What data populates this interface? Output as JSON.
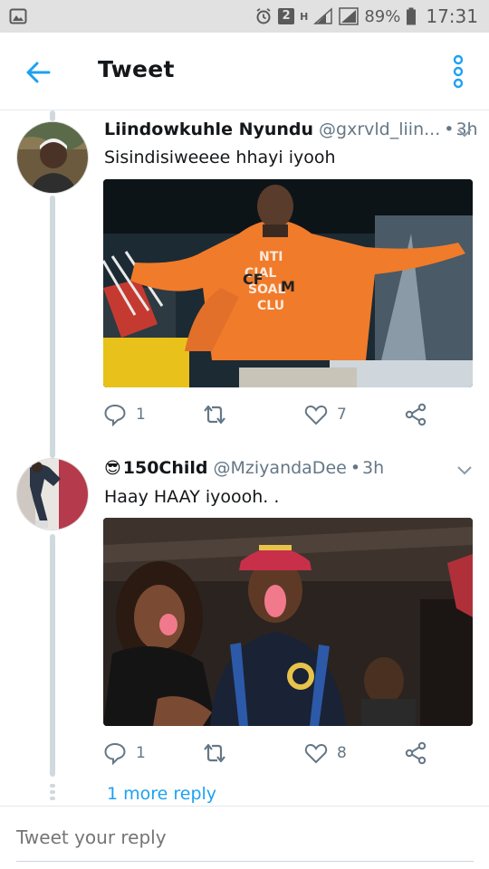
{
  "status_bar": {
    "network_label": "H",
    "sim_badge": "2",
    "battery": "89%",
    "time": "17:31"
  },
  "app_bar": {
    "title": "Tweet"
  },
  "tweets": [
    {
      "name": "Liindowkuhle Nyundu",
      "handle": "@gxrvld_liin...",
      "dot": "•",
      "time": "3h",
      "text": "Sisindisiweeee hhayi iyooh",
      "replies": "1",
      "likes": "7",
      "media_print": [
        "NTI",
        "CIAL",
        "SOAL",
        "CLU",
        "CF",
        "M"
      ]
    },
    {
      "emoji": "😎",
      "name": "150Child",
      "handle": "@MziyandaDee",
      "dot": "•",
      "time": "3h",
      "text": "Haay HAAY iyoooh. .",
      "replies": "1",
      "likes": "8"
    }
  ],
  "more_reply": "1 more reply",
  "reply": {
    "placeholder": "Tweet your reply"
  },
  "colors": {
    "accent": "#1da1f2",
    "muted": "#657786",
    "text": "#14171a",
    "status_bar": "#e1e1e1"
  },
  "icons": [
    "image-icon",
    "alarm-icon",
    "signal-icon",
    "battery-icon",
    "back-arrow-icon",
    "overflow-menu-icon",
    "chevron-down-icon",
    "reply-icon",
    "retweet-icon",
    "like-icon",
    "share-icon"
  ]
}
